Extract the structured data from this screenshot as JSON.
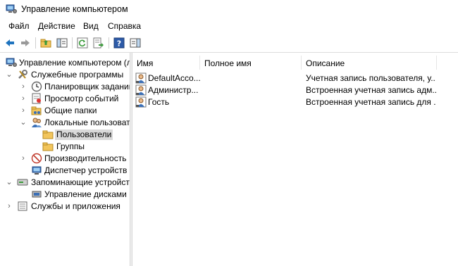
{
  "window": {
    "title": "Управление компьютером"
  },
  "menu": [
    {
      "label": "Файл"
    },
    {
      "label": "Действие"
    },
    {
      "label": "Вид"
    },
    {
      "label": "Справка"
    }
  ],
  "toolbar": {
    "buttons": [
      {
        "icon": "back-arrow-icon"
      },
      {
        "icon": "forward-arrow-icon"
      },
      {
        "icon": "up-folder-icon"
      },
      {
        "icon": "show-hide-tree-icon"
      },
      {
        "icon": "refresh-icon"
      },
      {
        "icon": "export-list-icon"
      },
      {
        "icon": "help-icon"
      },
      {
        "icon": "action-pane-icon"
      }
    ]
  },
  "tree": {
    "root": "Управление компьютером (л",
    "system_tools": "Служебные программы",
    "task_scheduler": "Планировщик заданий",
    "event_viewer": "Просмотр событий",
    "shared_folders": "Общие папки",
    "local_users": "Локальные пользовате",
    "users": "Пользователи",
    "groups": "Группы",
    "performance": "Производительность",
    "device_manager": "Диспетчер устройств",
    "storage": "Запоминающие устройст",
    "disk_management": "Управление дисками",
    "services_apps": "Службы и приложения"
  },
  "list": {
    "columns": [
      "Имя",
      "Полное имя",
      "Описание"
    ],
    "rows": [
      {
        "name": "DefaultAcco...",
        "full_name": "",
        "description": "Учетная запись пользователя, у..."
      },
      {
        "name": "Администр...",
        "full_name": "",
        "description": "Встроенная учетная запись адм..."
      },
      {
        "name": "Гость",
        "full_name": "",
        "description": "Встроенная учетная запись для ..."
      }
    ]
  },
  "colors": {
    "selection": "#d9d9d9",
    "folder": "#f2c55c",
    "arrow_blue": "#1e73be"
  }
}
